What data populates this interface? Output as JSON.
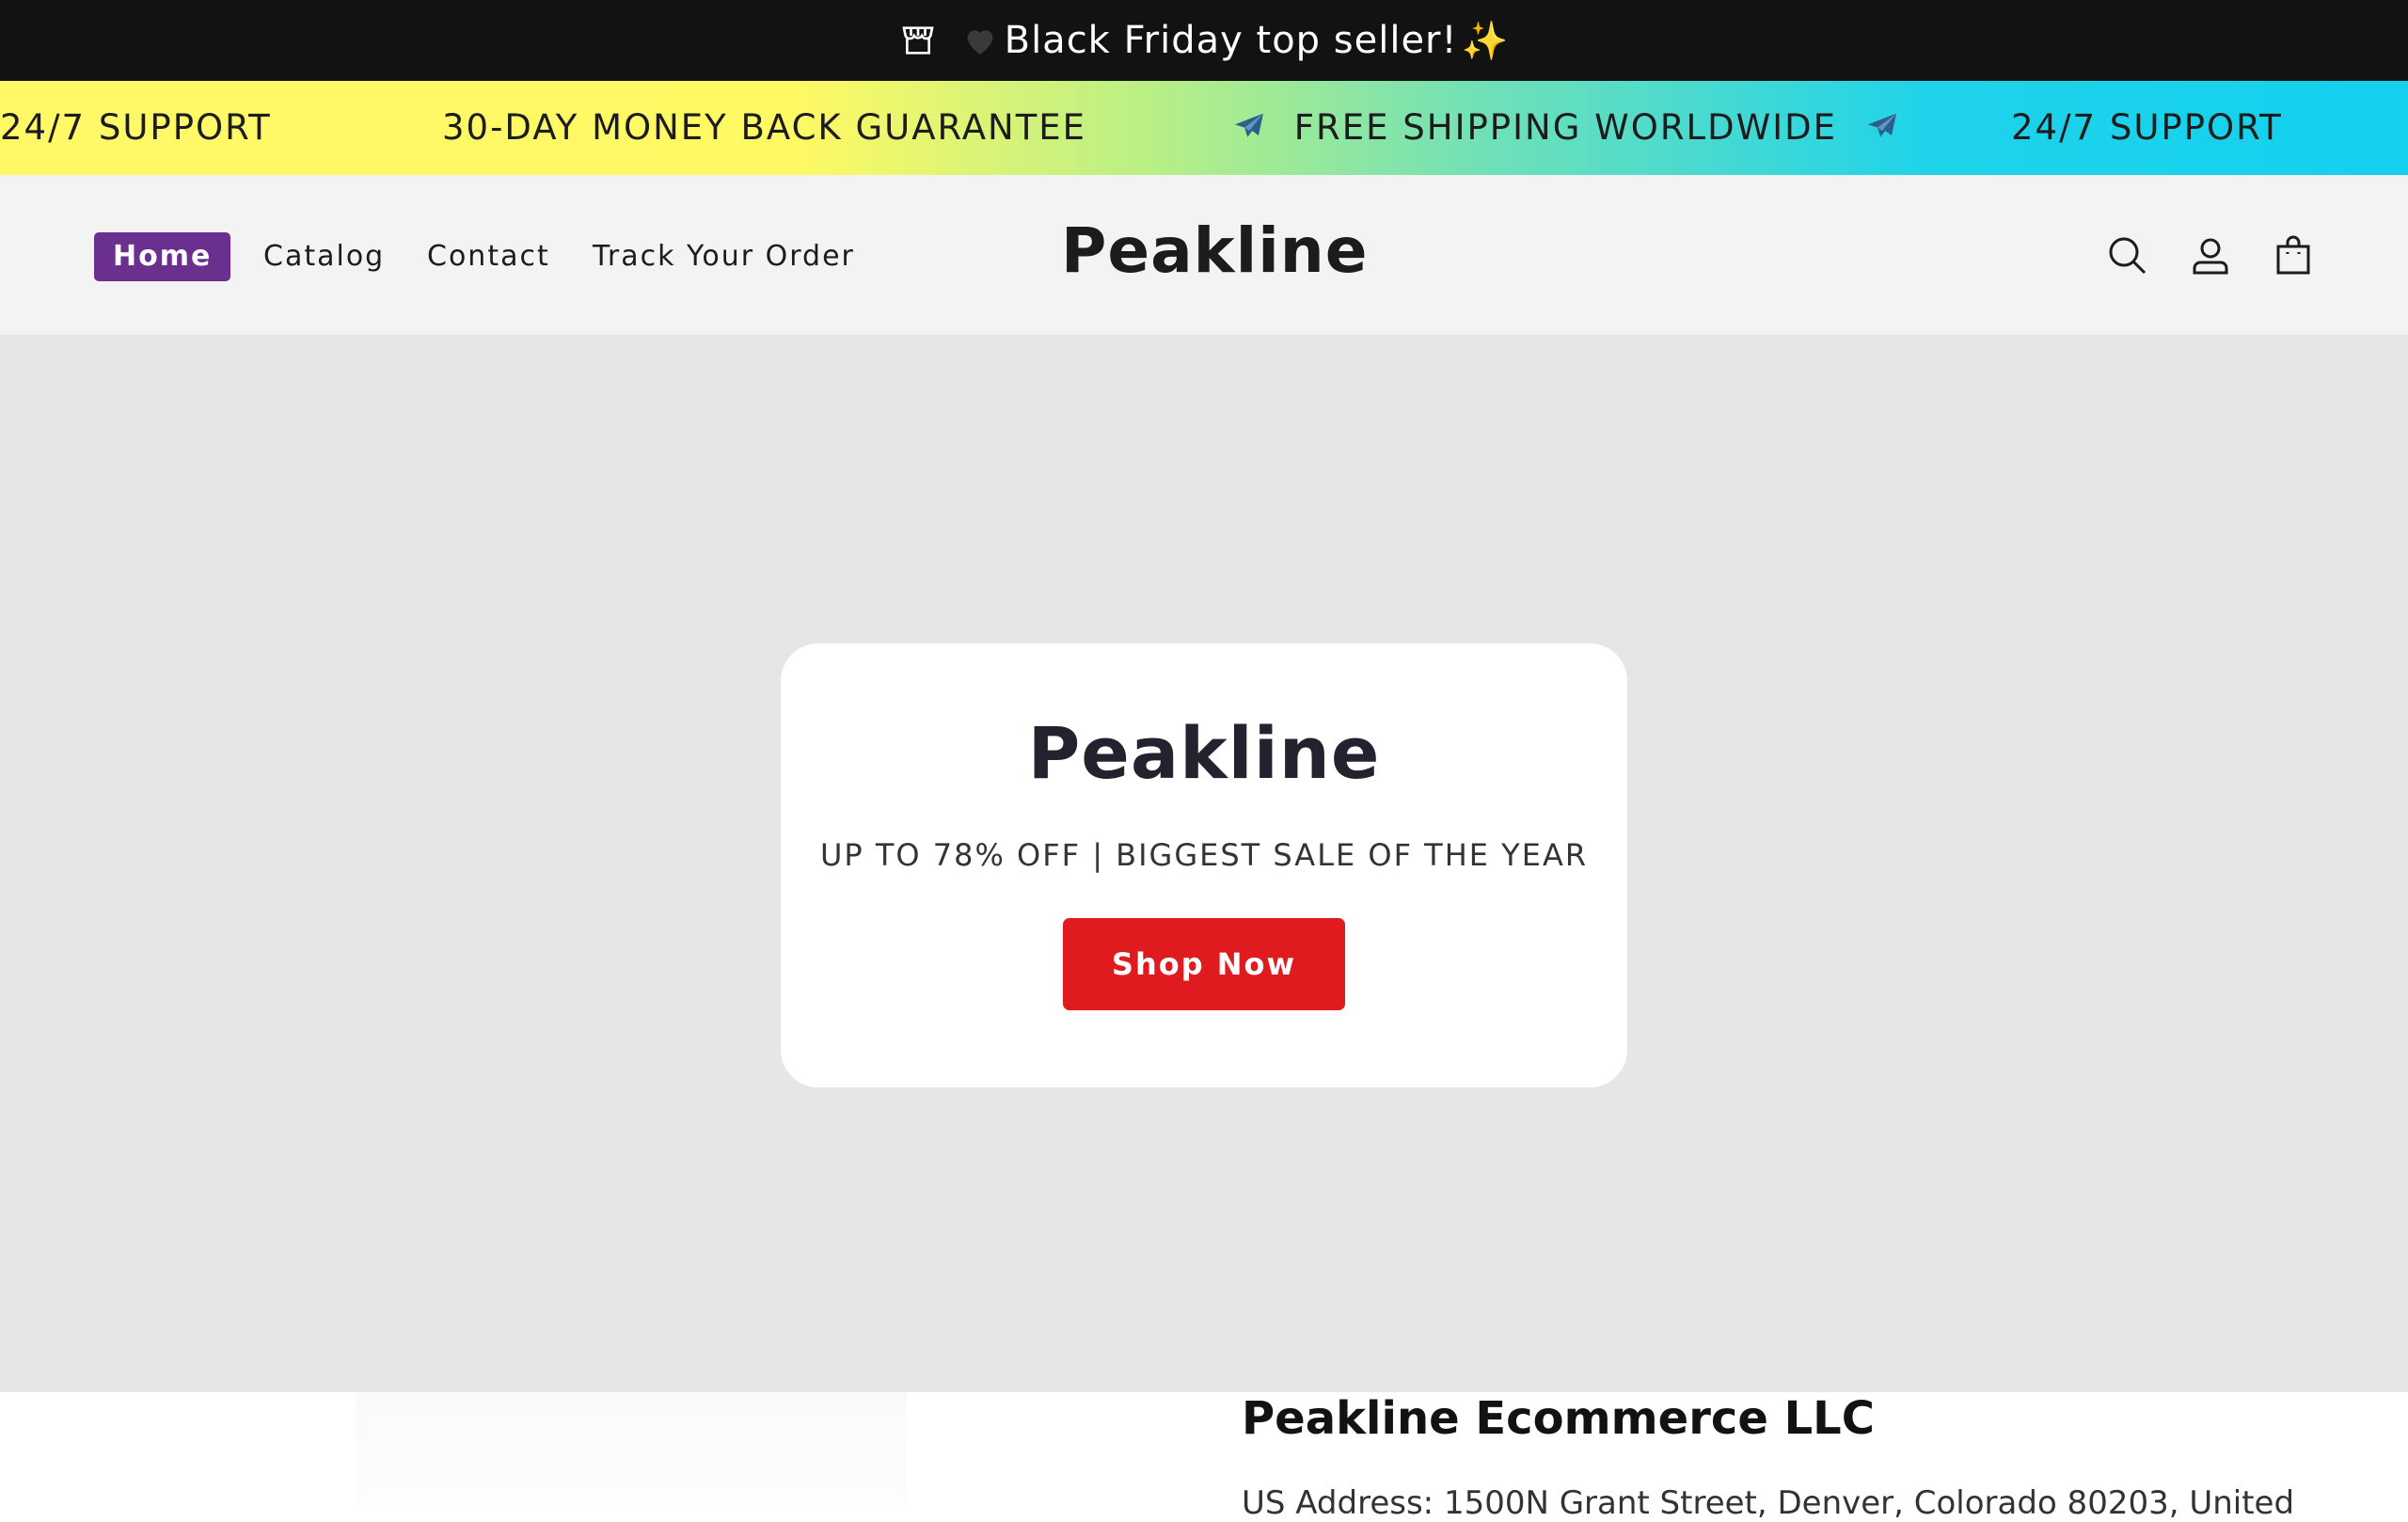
{
  "announcement": {
    "text": "Black Friday top seller!",
    "heart": "🖤",
    "sparkle": "✨",
    "store_icon": "store-icon"
  },
  "marquee": {
    "items": [
      "24/7 SUPPORT",
      "30-DAY MONEY BACK GUARANTEE",
      "FREE SHIPPING WORLDWIDE",
      "24/7 SUPPORT"
    ],
    "plane_icon": "airplane-icon"
  },
  "header": {
    "nav": [
      "Home",
      "Catalog",
      "Contact",
      "Track Your Order"
    ],
    "logo": "Peakline",
    "icons": [
      "search-icon",
      "account-icon",
      "cart-icon"
    ],
    "active_color": "#6b2f8f"
  },
  "hero": {
    "title": "Peakline",
    "subtitle": "UP TO 78% OFF | BIGGEST SALE OF THE YEAR",
    "button": "Shop Now",
    "button_color": "#df1b1f"
  },
  "lower": {
    "company": "Peakline Ecommerce LLC",
    "address": "US Address: 1500N Grant Street, Denver, Colorado 80203, United"
  }
}
